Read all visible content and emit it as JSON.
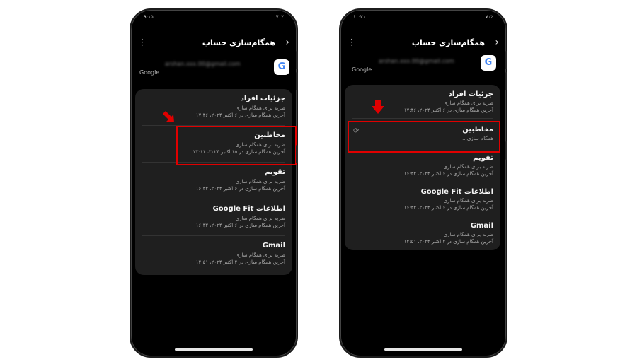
{
  "colors": {
    "highlight": "#e00000",
    "arrow": "#e00000"
  },
  "left_phone": {
    "status": {
      "left": "۹:۱۵",
      "right": "۷۰٪"
    },
    "header": {
      "title": "همگام‌سازی حساب",
      "menu_icon": "more-vert-icon",
      "back_icon": "chevron-right-icon"
    },
    "account": {
      "provider": "Google",
      "email": "arshan.xxx.00@gmail.com"
    },
    "items": [
      {
        "name": "جزئیات افراد",
        "line1": "ضربه برای همگام سازی",
        "line2": "آخرین همگام سازی در ۶ اکتبر ۲۰۲۴، ۱۷:۴۶"
      },
      {
        "name": "مخاطبین",
        "line1": "ضربه برای همگام سازی",
        "line2": "آخرین همگام سازی در ۱۵ اکتبر ۲۰۲۴، ۲۲:۱۱"
      },
      {
        "name": "تقویم",
        "line1": "ضربه برای همگام سازی",
        "line2": "آخرین همگام سازی در ۶ اکتبر ۲۰۲۴، ۱۶:۳۲"
      },
      {
        "name": "اطلاعات Google Fit",
        "line1": "ضربه برای همگام سازی",
        "line2": "آخرین همگام سازی در ۶ اکتبر ۲۰۲۴، ۱۶:۳۲"
      },
      {
        "name": "Gmail",
        "line1": "ضربه برای همگام سازی",
        "line2": "آخرین همگام سازی در ۴ اکتبر ۲۰۲۴، ۱۴:۵۱"
      }
    ]
  },
  "right_phone": {
    "status": {
      "left": "۱۰:۲۰",
      "right": "۷۰٪"
    },
    "header": {
      "title": "همگام‌سازی حساب",
      "menu_icon": "more-vert-icon",
      "back_icon": "chevron-right-icon"
    },
    "account": {
      "provider": "Google",
      "email": "arshan.xxx.00@gmail.com"
    },
    "items": [
      {
        "name": "جزئیات افراد",
        "line1": "ضربه برای همگام سازی",
        "line2": "آخرین همگام سازی در ۶ اکتبر ۲۰۲۴، ۱۷:۴۶"
      },
      {
        "name": "مخاطبین",
        "line1": "همگام سازی...",
        "line2": ""
      },
      {
        "name": "تقویم",
        "line1": "ضربه برای همگام سازی",
        "line2": "آخرین همگام سازی در ۶ اکتبر ۲۰۲۴، ۱۶:۳۲"
      },
      {
        "name": "اطلاعات Google Fit",
        "line1": "ضربه برای همگام سازی",
        "line2": "آخرین همگام سازی در ۶ اکتبر ۲۰۲۴، ۱۶:۳۲"
      },
      {
        "name": "Gmail",
        "line1": "ضربه برای همگام سازی",
        "line2": "آخرین همگام سازی در ۴ اکتبر ۲۰۲۴، ۱۴:۵۱"
      }
    ]
  }
}
